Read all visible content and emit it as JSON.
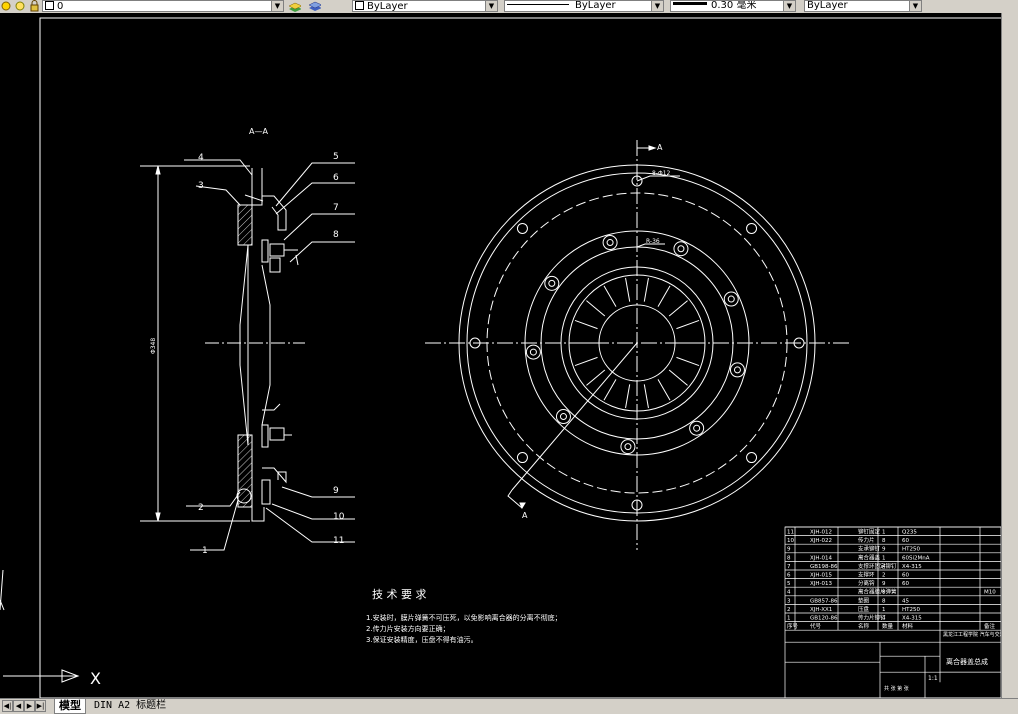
{
  "toolbar": {
    "layer_value": "0",
    "color_value": "ByLayer",
    "linetype_value": "ByLayer",
    "lineweight_value": "0.30 毫米",
    "plotstyle_value": "ByLayer"
  },
  "tabs": {
    "model": "模型",
    "layout": "DIN A2 标题栏"
  },
  "drawing": {
    "section_label": "A—A",
    "callouts_left": [
      "4",
      "3",
      "2",
      "1"
    ],
    "callouts_right": [
      "5",
      "6",
      "7",
      "8",
      "9",
      "10",
      "11"
    ],
    "dim_vertical": "Φ348",
    "view_marker_top": "A",
    "view_marker_bottom": "A",
    "hole_note_1": "8-Φ12",
    "hole_note_2": "R-36",
    "tech_title": "技 术 要 求",
    "tech_notes": [
      "1.安装时，膜片弹簧不可压死，以免影响离合器的分离不彻底；",
      "2.传力片安装方向要正确；",
      "3.保证安装精度，压盘不得有油污。"
    ],
    "axis_label": "X"
  },
  "bom": {
    "rows": [
      [
        "11",
        "XJH-012",
        "铆钉固定",
        "1",
        "Q235",
        ""
      ],
      [
        "10",
        "XJH-022",
        "传力片",
        "8",
        "60",
        ""
      ],
      [
        "9",
        "",
        "支承铆钉",
        "9",
        "HT250",
        ""
      ],
      [
        "8",
        "XJH-014",
        "离合器盖",
        "1",
        "60Si2MnA",
        ""
      ],
      [
        "7",
        "GB198-86",
        "支撑环固定铆钉",
        "4",
        "X4-315",
        ""
      ],
      [
        "6",
        "XJH-015",
        "支撑环",
        "2",
        "60",
        ""
      ],
      [
        "5",
        "XJH-013",
        "分离钩",
        "9",
        "60",
        ""
      ],
      [
        "4",
        "",
        "离合器膜片弹簧",
        "8",
        "",
        "M10"
      ],
      [
        "3",
        "GB857-86",
        "垫圈",
        "8",
        "45",
        ""
      ],
      [
        "2",
        "XJH-XX1",
        "压盘",
        "1",
        "HT250",
        ""
      ],
      [
        "1",
        "GB120-86",
        "传力片铆钉",
        "4",
        "X4-315",
        ""
      ]
    ],
    "header": [
      "序号",
      "代号",
      "名称",
      "数量",
      "材料",
      "备注"
    ],
    "company": "黑龙江工程学院 汽车与交通工程学院",
    "drawing_title": "离合器盖总成",
    "scale": "1:1",
    "sheet": "共 张 第 张"
  }
}
